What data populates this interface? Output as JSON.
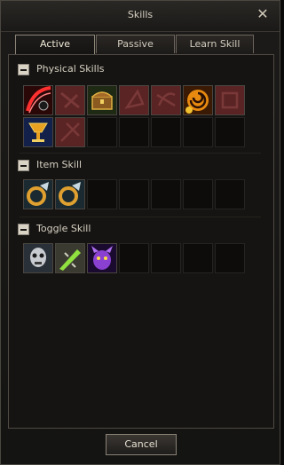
{
  "window": {
    "title": "Skills",
    "close_icon": "close-icon"
  },
  "tabs": [
    {
      "label": "Active",
      "selected": true
    },
    {
      "label": "Passive",
      "selected": false
    },
    {
      "label": "Learn Skill",
      "selected": false
    }
  ],
  "sections": [
    {
      "label": "Physical Skills",
      "toggle_icon": "minus-icon",
      "slots": [
        "slash-skill-icon",
        "locked-skill-icon",
        "treasure-chest-skill-icon",
        "locked-skill-icon",
        "locked-skill-icon",
        "fire-swirl-skill-icon",
        "locked-skill-icon",
        "goblet-skill-icon",
        "locked-skill-icon",
        "empty",
        "empty",
        "empty",
        "empty",
        "empty"
      ]
    },
    {
      "label": "Item Skill",
      "toggle_icon": "minus-icon",
      "slots": [
        "ring-item-icon",
        "ring-item-icon",
        "empty",
        "empty",
        "empty",
        "empty",
        "empty"
      ]
    },
    {
      "label": "Toggle Skill",
      "toggle_icon": "minus-icon",
      "slots": [
        "skull-mask-toggle-icon",
        "green-blade-toggle-icon",
        "purple-demon-toggle-icon",
        "empty",
        "empty",
        "empty",
        "empty"
      ]
    }
  ],
  "footer": {
    "cancel_label": "Cancel"
  },
  "colors": {
    "locked_slot": "#5a2424",
    "accent_tab": "#8c8477"
  }
}
